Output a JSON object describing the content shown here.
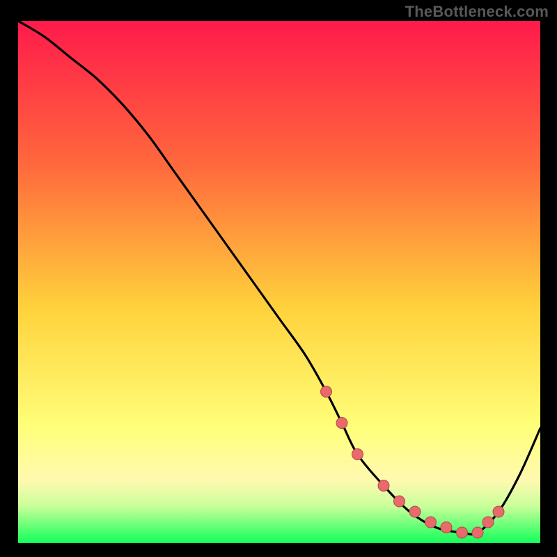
{
  "watermark": "TheBottleneck.com",
  "colors": {
    "frame": "#000000",
    "grad_top": "#ff1a4b",
    "grad_mid1": "#ff6a3c",
    "grad_mid2": "#ffd23c",
    "grad_lowpale": "#fff9b0",
    "grad_green_pale": "#c8ff9a",
    "grad_green": "#12ff5a",
    "curve": "#000000",
    "marker_fill": "#e96a6a",
    "marker_stroke": "#b24a4a"
  },
  "chart_data": {
    "type": "line",
    "title": "",
    "xlabel": "",
    "ylabel": "",
    "xlim": [
      0,
      100
    ],
    "ylim": [
      0,
      100
    ],
    "series": [
      {
        "name": "bottleneck-curve",
        "x": [
          0,
          5,
          10,
          15,
          20,
          25,
          30,
          35,
          40,
          45,
          50,
          55,
          59,
          62,
          65,
          70,
          75,
          80,
          85,
          88,
          92,
          96,
          100
        ],
        "y": [
          100,
          97,
          93,
          89,
          84,
          78,
          71,
          64,
          57,
          50,
          43,
          36,
          29,
          23,
          17,
          11,
          6,
          3,
          2,
          2,
          6,
          13,
          22
        ]
      }
    ],
    "markers": {
      "name": "highlight-points",
      "x": [
        59,
        62,
        65,
        70,
        73,
        76,
        79,
        82,
        85,
        88,
        90,
        92
      ],
      "y": [
        29,
        23,
        17,
        11,
        8,
        6,
        4,
        3,
        2,
        2,
        4,
        6
      ]
    }
  }
}
